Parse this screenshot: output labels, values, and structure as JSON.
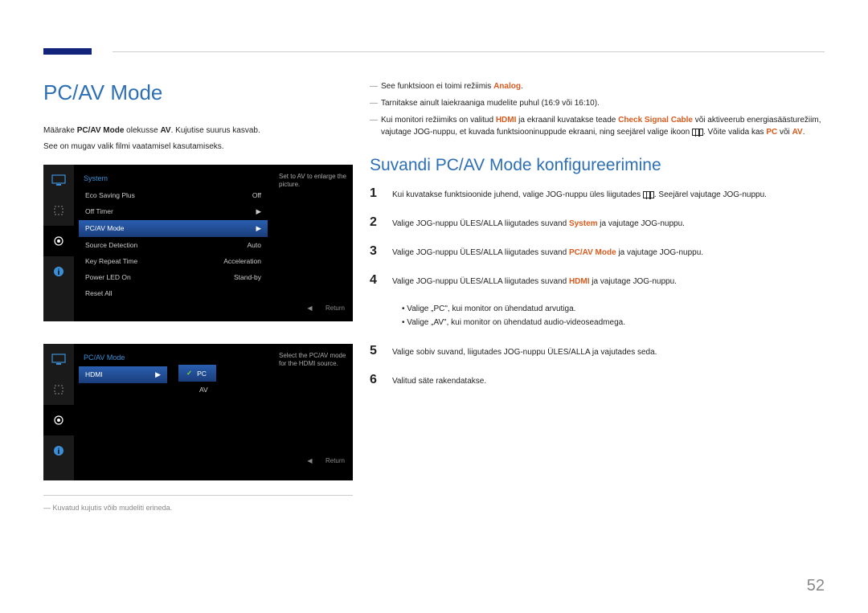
{
  "header": {
    "page_number": "52"
  },
  "left": {
    "title": "PC/AV Mode",
    "intro_pre": "Määrake ",
    "intro_bold1": "PC/AV Mode",
    "intro_mid": " olekusse ",
    "intro_bold2": "AV",
    "intro_post": ". Kujutise suurus kasvab.",
    "intro2": "See on mugav valik filmi vaatamisel kasutamiseks.",
    "footnote": "Kuvatud kujutis võib mudeliti erineda."
  },
  "osd1": {
    "title": "System",
    "hint": "Set to AV to enlarge the picture.",
    "rows": [
      {
        "label": "Eco Saving Plus",
        "value": "Off"
      },
      {
        "label": "Off Timer",
        "value": "▶"
      },
      {
        "label": "PC/AV Mode",
        "value": "▶",
        "sel": true
      },
      {
        "label": "Source Detection",
        "value": "Auto"
      },
      {
        "label": "Key Repeat Time",
        "value": "Acceleration"
      },
      {
        "label": "Power LED On",
        "value": "Stand-by"
      },
      {
        "label": "Reset All",
        "value": ""
      }
    ],
    "return": "Return"
  },
  "osd2": {
    "title": "PC/AV Mode",
    "hint": "Select the PC/AV mode for the HDMI source.",
    "row_label": "HDMI",
    "opts": [
      {
        "label": "PC",
        "sel": true
      },
      {
        "label": "AV"
      }
    ],
    "return": "Return"
  },
  "right": {
    "dash1_pre": "See funktsioon ei toimi režiimis ",
    "dash1_bold": "Analog",
    "dash1_post": ".",
    "dash2": "Tarnitakse ainult laiekraaniga mudelite puhul (16:9 või 16:10).",
    "dash3_a": "Kui monitori režiimiks on valitud ",
    "dash3_b": "HDMI",
    "dash3_c": " ja ekraanil kuvatakse teade ",
    "dash3_d": "Check Signal Cable",
    "dash3_e": " või aktiveerub energiasäästurežiim, vajutage JOG-nuppu, et kuvada funktsiooninuppude ekraani, ning seejärel valige ikoon ",
    "dash3_f": ". Võite valida kas ",
    "dash3_g": "PC",
    "dash3_h": " või ",
    "dash3_i": "AV",
    "dash3_j": ".",
    "section_title": "Suvandi PC/AV Mode konfigureerimine",
    "steps": {
      "s1a": "Kui kuvatakse funktsioonide juhend, valige JOG-nuppu üles liigutades ",
      "s1b": ". Seejärel vajutage JOG-nuppu.",
      "s2a": "Valige JOG-nuppu ÜLES/ALLA liigutades suvand ",
      "s2b": "System",
      "s2c": " ja vajutage JOG-nuppu.",
      "s3a": "Valige JOG-nuppu ÜLES/ALLA liigutades suvand ",
      "s3b": "PC/AV Mode",
      "s3c": " ja vajutage JOG-nuppu.",
      "s4a": "Valige JOG-nuppu ÜLES/ALLA liigutades suvand ",
      "s4b": "HDMI",
      "s4c": " ja vajutage JOG-nuppu.",
      "b1": "Valige „PC\", kui monitor on ühendatud arvutiga.",
      "b2": "Valige „AV\", kui monitor on ühendatud audio-videoseadmega.",
      "s5": "Valige sobiv suvand, liigutades JOG-nuppu ÜLES/ALLA ja vajutades seda.",
      "s6": "Valitud säte rakendatakse."
    }
  }
}
